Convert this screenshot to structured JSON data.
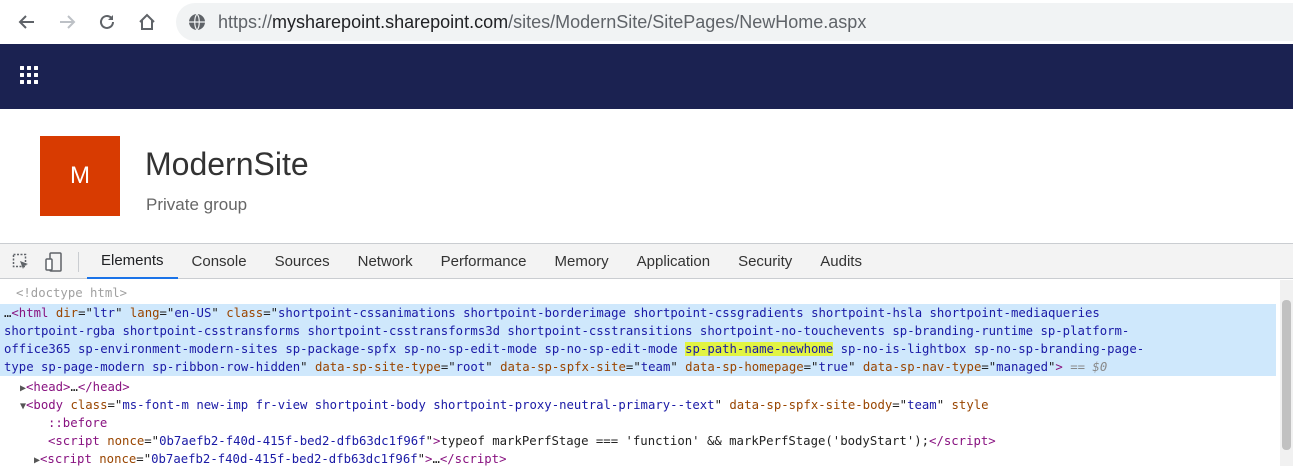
{
  "browser": {
    "url_prefix": "https://",
    "url_host": "mysharepoint.sharepoint.com",
    "url_path": "/sites/ModernSite/SitePages/NewHome.aspx"
  },
  "site": {
    "logo_letter": "M",
    "title": "ModernSite",
    "subtitle": "Private group",
    "logo_color": "#d83b01",
    "suitebar_color": "#1b2251"
  },
  "devtools": {
    "tabs": [
      "Elements",
      "Console",
      "Sources",
      "Network",
      "Performance",
      "Memory",
      "Application",
      "Security",
      "Audits"
    ],
    "active_tab": "Elements",
    "doctype": "<!doctype html>",
    "html_line1_lead": "…",
    "html_class_1": "shortpoint-cssanimations shortpoint-borderimage shortpoint-cssgradients shortpoint-hsla shortpoint-mediaqueries",
    "html_class_2": "shortpoint-rgba shortpoint-csstransforms shortpoint-csstransforms3d shortpoint-csstransitions shortpoint-no-touchevents sp-branding-runtime sp-platform-",
    "html_class_3a": "office365 sp-environment-modern-sites sp-package-spfx sp-no-sp-edit-mode sp-no-sp-edit-mode ",
    "html_class_highlight": "sp-path-name-newhome",
    "html_class_3b": " sp-no-is-lightbox sp-no-sp-branding-page-",
    "html_class_4": "type sp-page-modern sp-ribbon-row-hidden",
    "html_dir": "ltr",
    "html_lang": "en-US",
    "site_type": "root",
    "spfx_site": "team",
    "homepage": "true",
    "nav_type": "managed",
    "dollar0": "== $0",
    "body_class": "ms-font-m new-imp fr-view shortpoint-body shortpoint-proxy-neutral-primary--text",
    "body_spfx": "team",
    "before": "::before",
    "nonce": "0b7aefb2-f40d-415f-bed2-dfb63dc1f96f",
    "script_text": "typeof markPerfStage === 'function' && markPerfStage('bodyStart');"
  }
}
